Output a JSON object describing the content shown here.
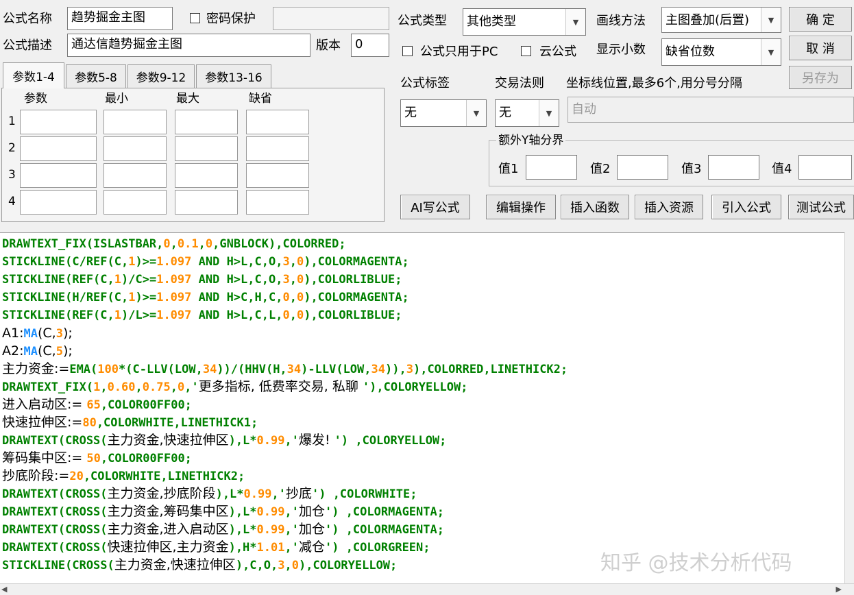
{
  "form": {
    "name_label": "公式名称",
    "name_value": "趋势掘金主图",
    "password_label": "密码保护",
    "password_value": "",
    "desc_label": "公式描述",
    "desc_value": "通达信趋势掘金主图",
    "version_label": "版本",
    "version_value": "0",
    "type_label": "公式类型",
    "type_value": "其他类型",
    "draw_label": "画线方法",
    "draw_value": "主图叠加(后置)",
    "pc_only_label": "公式只用于PC",
    "cloud_label": "云公式",
    "decimal_label": "显示小数",
    "decimal_value": "缺省位数",
    "tag_label": "公式标签",
    "tag_value": "无",
    "rule_label": "交易法则",
    "rule_value": "无",
    "axis_label": "坐标线位置,最多6个,用分号分隔",
    "axis_value": "自动",
    "extra_label": "额外Y轴分界",
    "val1_label": "值1",
    "val2_label": "值2",
    "val3_label": "值3",
    "val4_label": "值4"
  },
  "buttons": {
    "ok": "确  定",
    "cancel": "取  消",
    "save_as": "另存为",
    "ai": "AI写公式",
    "edit": "编辑操作",
    "insert_func": "插入函数",
    "insert_res": "插入资源",
    "import": "引入公式",
    "test": "测试公式"
  },
  "tabs": [
    "参数1-4",
    "参数5-8",
    "参数9-12",
    "参数13-16"
  ],
  "params": {
    "headers": [
      "参数",
      "最小",
      "最大",
      "缺省"
    ],
    "rows": [
      "1",
      "2",
      "3",
      "4"
    ]
  },
  "colors": {
    "green": "#008000",
    "orange": "#ff8c00",
    "blue": "#1e90ff",
    "black": "#000000"
  },
  "code": [
    [
      [
        "DRAWTEXT_FIX(ISLASTBAR,",
        "g"
      ],
      [
        "0",
        "o"
      ],
      [
        ",",
        "g"
      ],
      [
        "0.1",
        "o"
      ],
      [
        ",",
        "g"
      ],
      [
        "0",
        "o"
      ],
      [
        ",GNBLOCK),COLORRED;",
        "g"
      ]
    ],
    [
      [
        "STICKLINE(C/REF(C,",
        "g"
      ],
      [
        "1",
        "o"
      ],
      [
        ")>=",
        "g"
      ],
      [
        "1.097",
        "o"
      ],
      [
        " AND H>L,C,O,",
        "g"
      ],
      [
        "3",
        "o"
      ],
      [
        ",",
        "g"
      ],
      [
        "0",
        "o"
      ],
      [
        "),COLORMAGENTA;",
        "g"
      ]
    ],
    [
      [
        "STICKLINE(REF(C,",
        "g"
      ],
      [
        "1",
        "o"
      ],
      [
        ")/C>=",
        "g"
      ],
      [
        "1.097",
        "o"
      ],
      [
        " AND H>L,C,O,",
        "g"
      ],
      [
        "3",
        "o"
      ],
      [
        ",",
        "g"
      ],
      [
        "0",
        "o"
      ],
      [
        "),COLORLIBLUE;",
        "g"
      ]
    ],
    [
      [
        "STICKLINE(H/REF(C,",
        "g"
      ],
      [
        "1",
        "o"
      ],
      [
        ")>=",
        "g"
      ],
      [
        "1.097",
        "o"
      ],
      [
        " AND H>C,H,C,",
        "g"
      ],
      [
        "0",
        "o"
      ],
      [
        ",",
        "g"
      ],
      [
        "0",
        "o"
      ],
      [
        "),COLORMAGENTA;",
        "g"
      ]
    ],
    [
      [
        "STICKLINE(REF(C,",
        "g"
      ],
      [
        "1",
        "o"
      ],
      [
        ")/L>=",
        "g"
      ],
      [
        "1.097",
        "o"
      ],
      [
        " AND H>L,C,L,",
        "g"
      ],
      [
        "0",
        "o"
      ],
      [
        ",",
        "g"
      ],
      [
        "0",
        "o"
      ],
      [
        "),COLORLIBLUE;",
        "g"
      ]
    ],
    [
      [
        "A1:",
        "k"
      ],
      [
        "MA",
        "b"
      ],
      [
        "(C,",
        "k"
      ],
      [
        "3",
        "o"
      ],
      [
        ");",
        "k"
      ]
    ],
    [
      [
        "A2:",
        "k"
      ],
      [
        "MA",
        "b"
      ],
      [
        "(C,",
        "k"
      ],
      [
        "5",
        "o"
      ],
      [
        ");",
        "k"
      ]
    ],
    [
      [
        "主力资金:=",
        "k"
      ],
      [
        "EMA(",
        "g"
      ],
      [
        "100",
        "o"
      ],
      [
        "*(C-LLV(LOW,",
        "g"
      ],
      [
        "34",
        "o"
      ],
      [
        "))/(HHV(H,",
        "g"
      ],
      [
        "34",
        "o"
      ],
      [
        ")-LLV(LOW,",
        "g"
      ],
      [
        "34",
        "o"
      ],
      [
        ")),",
        "g"
      ],
      [
        "3",
        "o"
      ],
      [
        "),COLORRED,LINETHICK2;",
        "g"
      ]
    ],
    [
      [
        "DRAWTEXT_FIX(",
        "g"
      ],
      [
        "1",
        "o"
      ],
      [
        ",",
        "g"
      ],
      [
        "0.60",
        "o"
      ],
      [
        ",",
        "g"
      ],
      [
        "0.75",
        "o"
      ],
      [
        ",",
        "g"
      ],
      [
        "0",
        "o"
      ],
      [
        ",'",
        "g"
      ],
      [
        "更多指标, 低费率交易, 私聊 ",
        "k"
      ],
      [
        "'),COLORYELLOW;",
        "g"
      ]
    ],
    [
      [
        "进入启动区:= ",
        "k"
      ],
      [
        "65",
        "o"
      ],
      [
        ",COLOR00FF00;",
        "g"
      ]
    ],
    [
      [
        "快速拉伸区:=",
        "k"
      ],
      [
        "80",
        "o"
      ],
      [
        ",COLORWHITE,LINETHICK1;",
        "g"
      ]
    ],
    [
      [
        "DRAWTEXT(CROSS(",
        "g"
      ],
      [
        "主力资金,快速拉伸区",
        "k"
      ],
      [
        "),L*",
        "g"
      ],
      [
        "0.99",
        "o"
      ],
      [
        ",'",
        "g"
      ],
      [
        "爆发! ",
        "k"
      ],
      [
        "') ,COLORYELLOW;",
        "g"
      ]
    ],
    [
      [
        "筹码集中区:= ",
        "k"
      ],
      [
        "50",
        "o"
      ],
      [
        ",COLOR00FF00;",
        "g"
      ]
    ],
    [
      [
        "抄底阶段:=",
        "k"
      ],
      [
        "20",
        "o"
      ],
      [
        ",COLORWHITE,LINETHICK2;",
        "g"
      ]
    ],
    [
      [
        "DRAWTEXT(CROSS(",
        "g"
      ],
      [
        "主力资金,抄底阶段",
        "k"
      ],
      [
        "),L*",
        "g"
      ],
      [
        "0.99",
        "o"
      ],
      [
        ",'",
        "g"
      ],
      [
        "抄底",
        "k"
      ],
      [
        "') ,COLORWHITE;",
        "g"
      ]
    ],
    [
      [
        "DRAWTEXT(CROSS(",
        "g"
      ],
      [
        "主力资金,筹码集中区",
        "k"
      ],
      [
        "),L*",
        "g"
      ],
      [
        "0.99",
        "o"
      ],
      [
        ",'",
        "g"
      ],
      [
        "加仓",
        "k"
      ],
      [
        "') ,COLORMAGENTA;",
        "g"
      ]
    ],
    [
      [
        "DRAWTEXT(CROSS(",
        "g"
      ],
      [
        "主力资金,进入启动区",
        "k"
      ],
      [
        "),L*",
        "g"
      ],
      [
        "0.99",
        "o"
      ],
      [
        ",'",
        "g"
      ],
      [
        "加仓",
        "k"
      ],
      [
        "') ,COLORMAGENTA;",
        "g"
      ]
    ],
    [
      [
        "DRAWTEXT(CROSS(",
        "g"
      ],
      [
        "快速拉伸区,主力资金",
        "k"
      ],
      [
        "),H*",
        "g"
      ],
      [
        "1.01",
        "o"
      ],
      [
        ",'",
        "g"
      ],
      [
        "减仓",
        "k"
      ],
      [
        "') ,COLORGREEN;",
        "g"
      ]
    ],
    [
      [
        "STICKLINE(CROSS(",
        "g"
      ],
      [
        "主力资金,快速拉伸区",
        "k"
      ],
      [
        "),C,O,",
        "g"
      ],
      [
        "3",
        "o"
      ],
      [
        ",",
        "g"
      ],
      [
        "0",
        "o"
      ],
      [
        "),COLORYELLOW;",
        "g"
      ]
    ]
  ],
  "watermark": "知乎 @技术分析代码"
}
